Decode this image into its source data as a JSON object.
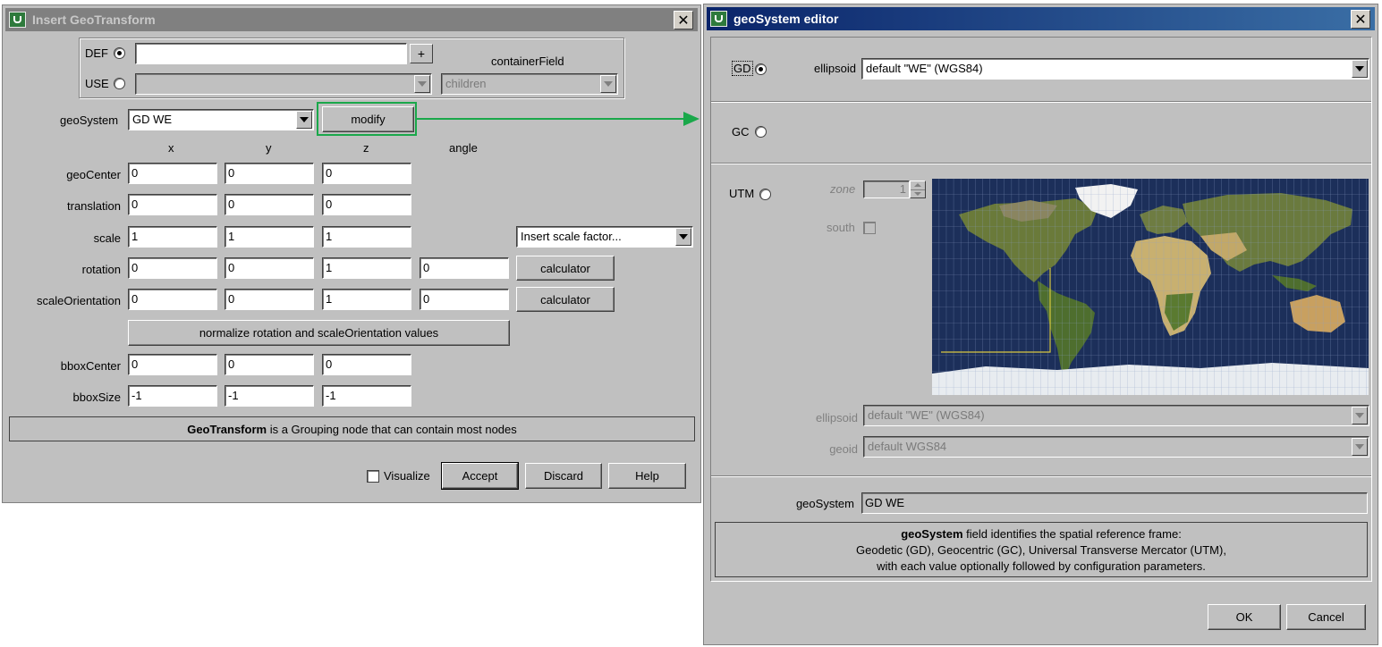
{
  "insert_dialog": {
    "title": "Insert GeoTransform",
    "def_label": "DEF",
    "def_value": "",
    "def_add": "+",
    "use_label": "USE",
    "use_value": "",
    "container_field_label": "containerField",
    "container_field_value": "children",
    "geosystem_label": "geoSystem",
    "geosystem_value": "GD WE",
    "modify_label": "modify",
    "col_headers": [
      "x",
      "y",
      "z",
      "angle"
    ],
    "rows": [
      {
        "label": "geoCenter",
        "values": [
          "0",
          "0",
          "0"
        ]
      },
      {
        "label": "translation",
        "values": [
          "0",
          "0",
          "0"
        ]
      },
      {
        "label": "scale",
        "values": [
          "1",
          "1",
          "1"
        ]
      },
      {
        "label": "rotation",
        "values": [
          "0",
          "0",
          "1",
          "0"
        ]
      },
      {
        "label": "scaleOrientation",
        "values": [
          "0",
          "0",
          "1",
          "0"
        ]
      },
      {
        "label": "bboxCenter",
        "values": [
          "0",
          "0",
          "0"
        ]
      },
      {
        "label": "bboxSize",
        "values": [
          "-1",
          "-1",
          "-1"
        ]
      }
    ],
    "scale_factor_value": "Insert scale factor...",
    "calculator_label": "calculator",
    "normalize_label": "normalize rotation and scaleOrientation values",
    "info_bold": "GeoTransform",
    "info_rest": " is a Grouping node that can contain most nodes",
    "visualize_label": "Visualize",
    "accept_label": "Accept",
    "discard_label": "Discard",
    "help_label": "Help"
  },
  "geosystem_editor": {
    "title": "geoSystem editor",
    "gd_label": "GD",
    "ellipsoid_label": "ellipsoid",
    "ellipsoid_value": "default \"WE\" (WGS84)",
    "gc_label": "GC",
    "utm_label": "UTM",
    "zone_label": "zone",
    "zone_value": "1",
    "south_label": "south",
    "utm_ellipsoid_label": "ellipsoid",
    "utm_ellipsoid_value": "default \"WE\" (WGS84)",
    "geoid_label": "geoid",
    "geoid_value": "default WGS84",
    "geosystem_label": "geoSystem",
    "geosystem_value": "GD WE",
    "info_bold": "geoSystem",
    "info_line1_rest": " field identifies the spatial reference frame:",
    "info_line2": "Geodetic (GD), Geocentric (GC), Universal Transverse Mercator (UTM),",
    "info_line3": "with each value optionally followed by configuration parameters.",
    "ok_label": "OK",
    "cancel_label": "Cancel"
  },
  "colors": {
    "dialog_bg": "#c0c0c0",
    "annotation_green": "#1aa84a",
    "ocean": "#1c2f5a",
    "active_title": "#0a246a"
  }
}
